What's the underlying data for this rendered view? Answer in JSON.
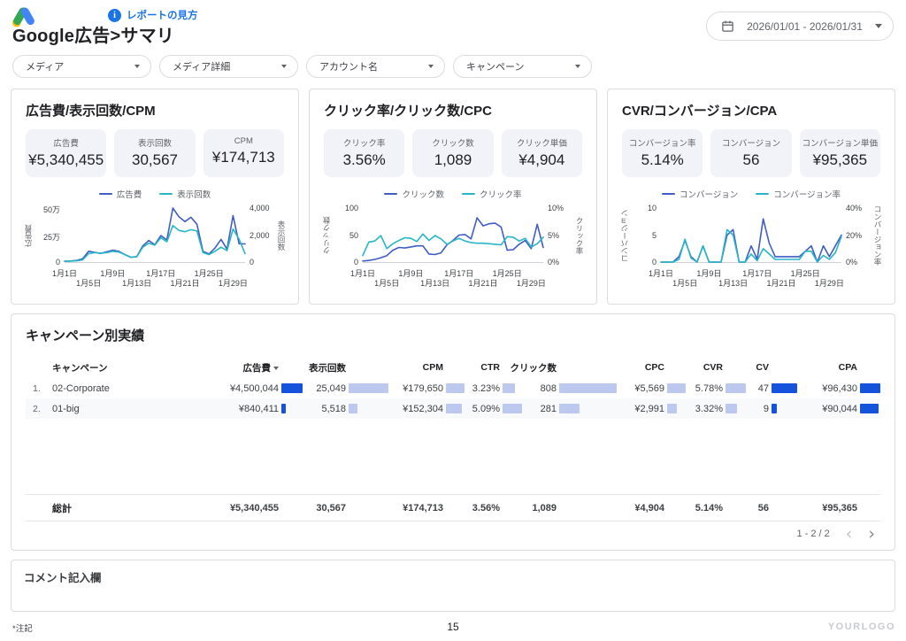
{
  "colors": {
    "accent_blue": "#1a73e8",
    "series_blue": "#3f5dc4",
    "series_teal": "#27b6c7",
    "bar_dark": "#1653dd",
    "bar_light": "#bcc8ee"
  },
  "header": {
    "help_label": "レポートの見方",
    "title": "Google広告>サマリ",
    "date_range": "2026/01/01 - 2026/01/31"
  },
  "filters": [
    {
      "label": "メディア"
    },
    {
      "label": "メディア詳細"
    },
    {
      "label": "アカウント名"
    },
    {
      "label": "キャンペーン"
    }
  ],
  "charts": [
    {
      "type": "line",
      "title": "広告費/表示回数/CPM",
      "stats": [
        {
          "label": "広告費",
          "value": "¥5,340,455"
        },
        {
          "label": "表示回数",
          "value": "30,567"
        },
        {
          "label": "CPM",
          "value": "¥174,713"
        }
      ],
      "legend": [
        "広告費",
        "表示回数"
      ],
      "left_axis": {
        "title": "広告費",
        "ticks": [
          "50万",
          "25万",
          "0"
        ],
        "max": 500000
      },
      "right_axis": {
        "title": "表示回数",
        "ticks": [
          "4,000",
          "2,000",
          "0"
        ],
        "max": 4000
      },
      "x_ticks": [
        {
          "label": "1月1日",
          "day": 1,
          "row": 1
        },
        {
          "label": "1月5日",
          "day": 5,
          "row": 2
        },
        {
          "label": "1月9日",
          "day": 9,
          "row": 1
        },
        {
          "label": "1月13日",
          "day": 13,
          "row": 2
        },
        {
          "label": "1月17日",
          "day": 17,
          "row": 1
        },
        {
          "label": "1月21日",
          "day": 21,
          "row": 2
        },
        {
          "label": "1月25日",
          "day": 25,
          "row": 1
        },
        {
          "label": "1月29日",
          "day": 29,
          "row": 2
        }
      ],
      "series": [
        {
          "name": "広告費",
          "axis": "left",
          "max": 500000,
          "values": [
            8000,
            10000,
            15000,
            30000,
            100000,
            90000,
            80000,
            95000,
            110000,
            100000,
            70000,
            45000,
            50000,
            150000,
            200000,
            160000,
            245000,
            205000,
            500000,
            420000,
            375000,
            415000,
            350000,
            100000,
            75000,
            130000,
            210000,
            120000,
            430000,
            170000,
            168000
          ]
        },
        {
          "name": "表示回数",
          "axis": "right",
          "max": 4000,
          "values": [
            60,
            70,
            90,
            160,
            620,
            700,
            650,
            700,
            800,
            750,
            560,
            350,
            400,
            1100,
            1400,
            1250,
            1800,
            1500,
            2700,
            2350,
            2250,
            2400,
            2300,
            700,
            550,
            800,
            1100,
            850,
            2450,
            1700,
            620
          ]
        }
      ]
    },
    {
      "type": "line",
      "title": "クリック率/クリック数/CPC",
      "stats": [
        {
          "label": "クリック率",
          "value": "3.56%"
        },
        {
          "label": "クリック数",
          "value": "1,089"
        },
        {
          "label": "クリック単価",
          "value": "¥4,904"
        }
      ],
      "legend": [
        "クリック数",
        "クリック率"
      ],
      "left_axis": {
        "title": "クリック数",
        "ticks": [
          "100",
          "50",
          "0"
        ],
        "max": 100
      },
      "right_axis": {
        "title": "クリック率",
        "ticks": [
          "10%",
          "5%",
          "0%"
        ],
        "max": 10
      },
      "x_ticks": [
        {
          "label": "1月1日",
          "day": 1,
          "row": 1
        },
        {
          "label": "1月5日",
          "day": 5,
          "row": 2
        },
        {
          "label": "1月9日",
          "day": 9,
          "row": 1
        },
        {
          "label": "1月13日",
          "day": 13,
          "row": 2
        },
        {
          "label": "1月17日",
          "day": 17,
          "row": 1
        },
        {
          "label": "1月21日",
          "day": 21,
          "row": 2
        },
        {
          "label": "1月25日",
          "day": 25,
          "row": 1
        },
        {
          "label": "1月29日",
          "day": 29,
          "row": 2
        }
      ],
      "series": [
        {
          "name": "クリック数",
          "axis": "left",
          "max": 100,
          "values": [
            2,
            3,
            5,
            8,
            12,
            22,
            27,
            26,
            28,
            30,
            30,
            15,
            14,
            17,
            32,
            40,
            50,
            51,
            43,
            82,
            67,
            71,
            72,
            65,
            22,
            23,
            33,
            40,
            25,
            70,
            27
          ]
        },
        {
          "name": "クリック率",
          "axis": "right",
          "max": 10,
          "values": [
            1.2,
            3.7,
            3.9,
            4.9,
            2.5,
            3.4,
            4,
            4.5,
            4.4,
            3.8,
            5.2,
            4,
            4.9,
            4.3,
            3.3,
            3.9,
            4.4,
            3.9,
            3.6,
            3.5,
            3.5,
            3.4,
            3.3,
            3.2,
            4.7,
            4.6,
            3.9,
            4.4,
            2.8,
            3.4,
            4.6
          ]
        }
      ]
    },
    {
      "type": "line",
      "title": "CVR/コンバージョン/CPA",
      "stats": [
        {
          "label": "コンバージョン率",
          "value": "5.14%"
        },
        {
          "label": "コンバージョン",
          "value": "56"
        },
        {
          "label": "コンバージョン単価",
          "value": "¥95,365"
        }
      ],
      "legend": [
        "コンバージョン",
        "コンバージョン率"
      ],
      "left_axis": {
        "title": "コンバージョン",
        "ticks": [
          "10",
          "5",
          "0"
        ],
        "max": 10
      },
      "right_axis": {
        "title": "コンバージョン率",
        "ticks": [
          "40%",
          "20%",
          "0%"
        ],
        "max": 40
      },
      "x_ticks": [
        {
          "label": "1月1日",
          "day": 1,
          "row": 1
        },
        {
          "label": "1月5日",
          "day": 5,
          "row": 2
        },
        {
          "label": "1月9日",
          "day": 9,
          "row": 1
        },
        {
          "label": "1月13日",
          "day": 13,
          "row": 2
        },
        {
          "label": "1月17日",
          "day": 17,
          "row": 1
        },
        {
          "label": "1月21日",
          "day": 21,
          "row": 2
        },
        {
          "label": "1月25日",
          "day": 25,
          "row": 1
        },
        {
          "label": "1月29日",
          "day": 29,
          "row": 2
        }
      ],
      "series": [
        {
          "name": "コンバージョン",
          "axis": "left",
          "max": 10,
          "values": [
            0,
            0,
            0,
            1,
            4,
            1,
            0,
            3,
            0,
            0,
            0,
            5,
            6,
            0,
            0,
            3,
            0.5,
            8,
            3.5,
            1,
            1,
            1,
            1,
            1,
            2,
            3,
            0,
            3,
            1,
            3,
            5
          ]
        },
        {
          "name": "コンバージョン率",
          "axis": "right",
          "max": 40,
          "values": [
            0,
            0,
            0,
            2,
            17,
            3,
            0,
            12,
            0,
            0,
            0,
            24,
            20,
            0,
            0,
            6,
            1,
            10,
            6,
            2,
            2,
            2,
            2,
            2,
            8,
            8,
            0,
            5,
            2,
            7,
            19
          ]
        }
      ]
    }
  ],
  "table": {
    "title": "キャンペーン別実績",
    "columns": [
      "キャンペーン",
      "広告費",
      "表示回数",
      "CPM",
      "CTR",
      "クリック数",
      "CPC",
      "CVR",
      "CV",
      "CPA"
    ],
    "sort_column": "広告費",
    "rows": [
      {
        "num": "1.",
        "name": "02-Corporate",
        "ad_cost": "¥4,500,044",
        "impressions": "25,049",
        "cpm": "¥179,650",
        "ctr": "3.23%",
        "clicks": "808",
        "cpc": "¥5,569",
        "cvr": "5.78%",
        "cv": "47",
        "cpa": "¥96,430",
        "bars": {
          "ad_cost": "24px",
          "impressions": "45px",
          "cpm": "21px",
          "ctr": "14px",
          "clicks": "65px",
          "cpc": "21px",
          "cvr": "23px",
          "cv": "29px",
          "cpa": "23px"
        }
      },
      {
        "num": "2.",
        "name": "01-big",
        "ad_cost": "¥840,411",
        "impressions": "5,518",
        "cpm": "¥152,304",
        "ctr": "5.09%",
        "clicks": "281",
        "cpc": "¥2,991",
        "cvr": "3.32%",
        "cv": "9",
        "cpa": "¥90,044",
        "bars": {
          "ad_cost": "5px",
          "impressions": "10px",
          "cpm": "18px",
          "ctr": "22px",
          "clicks": "23px",
          "cpc": "11px",
          "cvr": "13px",
          "cv": "6px",
          "cpa": "21px"
        }
      }
    ],
    "totals": {
      "label": "総計",
      "ad_cost": "¥5,340,455",
      "impressions": "30,567",
      "cpm": "¥174,713",
      "ctr": "3.56%",
      "clicks": "1,089",
      "cpc": "¥4,904",
      "cvr": "5.14%",
      "cv": "56",
      "cpa": "¥95,365"
    },
    "pagination": {
      "range": "1 - 2 / 2",
      "prev": "‹",
      "next": "›"
    }
  },
  "comment": {
    "label": "コメント記入欄"
  },
  "footer": {
    "note": "*注記",
    "page": "15",
    "logo": "YOURLOGO"
  }
}
